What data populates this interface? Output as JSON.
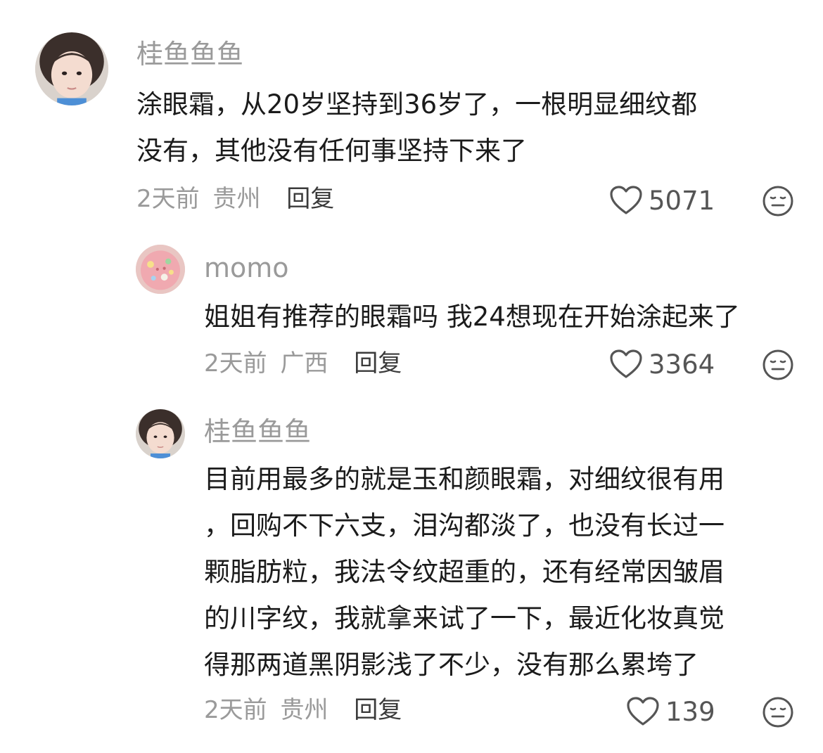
{
  "comments": [
    {
      "username": "桂鱼鱼鱼",
      "text_lines": [
        "涂眼霜，从20岁坚持到36岁了，一根明显细纹都",
        "没有，其他没有任何事坚持下来了"
      ],
      "time": "2天前",
      "location": "贵州",
      "reply_label": "回复",
      "likes": "5071",
      "avatar_icon": "avatar-girl"
    },
    {
      "username": "momo",
      "text_lines": [
        "姐姐有推荐的眼霜吗 我24想现在开始涂起来了"
      ],
      "time": "2天前",
      "location": "广西",
      "reply_label": "回复",
      "likes": "3364",
      "avatar_icon": "avatar-pink-cookie"
    },
    {
      "username": "桂鱼鱼鱼",
      "text_lines": [
        "目前用最多的就是玉和颜眼霜，对细纹很有用",
        "，回购不下六支，泪沟都淡了，也没有长过一",
        "颗脂肪粒，我法令纹超重的，还有经常因皱眉",
        "的川字纹，我就拿来试了一下，最近化妆真觉",
        "得那两道黑阴影浅了不少，没有那么累垮了"
      ],
      "time": "2天前",
      "location": "贵州",
      "reply_label": "回复",
      "likes": "139",
      "avatar_icon": "avatar-girl"
    }
  ],
  "icons": {
    "like": "heart-outline-icon",
    "dislike": "meh-face-icon"
  },
  "colors": {
    "username": "#9a9a9a",
    "text": "#1b1b1b",
    "meta": "#9a9a9a",
    "reply": "#3a3a3a",
    "icon": "#555555"
  }
}
